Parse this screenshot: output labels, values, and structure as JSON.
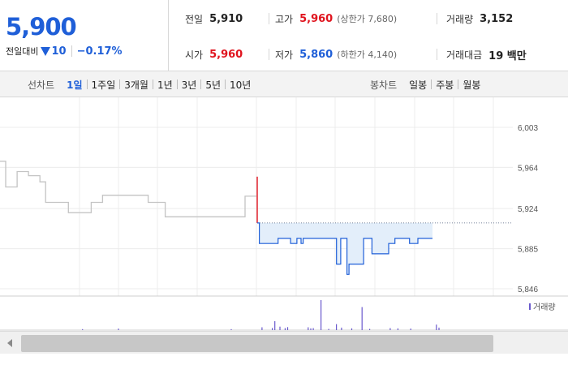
{
  "header": {
    "price": "5,900",
    "change_label": "전일대비",
    "change_amount": "10",
    "change_percent": "−0.17%"
  },
  "stats": {
    "prev_close": {
      "label": "전일",
      "value": "5,910"
    },
    "high": {
      "label": "고가",
      "value": "5,960",
      "sub": "(상한가 7,680)"
    },
    "volume": {
      "label": "거래량",
      "value": "3,152"
    },
    "open": {
      "label": "시가",
      "value": "5,960"
    },
    "low": {
      "label": "저가",
      "value": "5,860",
      "sub": "(하한가 4,140)"
    },
    "amount": {
      "label": "거래대금",
      "value": "19 백만"
    }
  },
  "toolbar": {
    "line_label": "선차트",
    "line_periods": [
      "1일",
      "1주일",
      "3개월",
      "1년",
      "3년",
      "5년",
      "10년"
    ],
    "candle_label": "봉차트",
    "candle_periods": [
      "일봉",
      "주봉",
      "월봉"
    ]
  },
  "colors": {
    "down": "#1f5fd8",
    "up": "#e0141e",
    "previous_day_line": "#c4c4c4",
    "area_fill": "#e3eefa",
    "volume_bar": "#6a5acd"
  },
  "chart_data": {
    "type": "line",
    "ylim": [
      5846,
      6003
    ],
    "y_ticks": [
      6003,
      5964,
      5924,
      5885,
      5846
    ],
    "reference_level": 5910,
    "series": [
      {
        "values": [
          5970,
          5945,
          5945,
          5960,
          5960,
          5956,
          5956,
          5950,
          5930,
          5930,
          5930,
          5930,
          5920,
          5920,
          5920,
          5920,
          5930,
          5930,
          5937,
          5937,
          5937,
          5937,
          5937,
          5937,
          5937,
          5937,
          5930,
          5930,
          5930,
          5916,
          5916,
          5916,
          5916,
          5916,
          5916,
          5916,
          5916,
          5916,
          5916,
          5916,
          5916,
          5916,
          5916,
          5936,
          5936
        ]
      },
      {
        "values": [
          5955,
          5910,
          5890,
          5890,
          5890,
          5890,
          5890,
          5890,
          5890,
          5890,
          5890,
          5895,
          5895,
          5895,
          5895,
          5895,
          5895,
          5890,
          5890,
          5890,
          5895,
          5895,
          5890,
          5895,
          5895,
          5895,
          5895,
          5895,
          5895,
          5895,
          5895,
          5895,
          5895,
          5895,
          5895,
          5895,
          5895,
          5895,
          5895,
          5870,
          5870,
          5895,
          5895,
          5895,
          5860,
          5870,
          5870,
          5870,
          5870,
          5870,
          5870,
          5870,
          5895,
          5895,
          5895,
          5895,
          5880,
          5880,
          5880,
          5880,
          5880,
          5880,
          5880,
          5880,
          5890,
          5890,
          5890,
          5895,
          5895,
          5895,
          5895,
          5895,
          5895,
          5895,
          5890,
          5890,
          5890,
          5890,
          5895,
          5895,
          5895,
          5895,
          5895,
          5895,
          5895
        ]
      }
    ],
    "volume_legend": "거래량",
    "volume": [
      {
        "x": 0.16,
        "v": 10
      },
      {
        "x": 0.23,
        "v": 15
      },
      {
        "x": 0.45,
        "v": 10
      },
      {
        "x": 0.51,
        "v": 28
      },
      {
        "x": 0.53,
        "v": 22
      },
      {
        "x": 0.535,
        "v": 90
      },
      {
        "x": 0.545,
        "v": 35
      },
      {
        "x": 0.555,
        "v": 20
      },
      {
        "x": 0.56,
        "v": 30
      },
      {
        "x": 0.6,
        "v": 28
      },
      {
        "x": 0.605,
        "v": 18
      },
      {
        "x": 0.61,
        "v": 20
      },
      {
        "x": 0.625,
        "v": 300
      },
      {
        "x": 0.64,
        "v": 12
      },
      {
        "x": 0.655,
        "v": 60
      },
      {
        "x": 0.665,
        "v": 25
      },
      {
        "x": 0.685,
        "v": 18
      },
      {
        "x": 0.705,
        "v": 230
      },
      {
        "x": 0.72,
        "v": 12
      },
      {
        "x": 0.76,
        "v": 20
      },
      {
        "x": 0.775,
        "v": 18
      },
      {
        "x": 0.8,
        "v": 15
      },
      {
        "x": 0.85,
        "v": 55
      },
      {
        "x": 0.855,
        "v": 25
      }
    ]
  }
}
